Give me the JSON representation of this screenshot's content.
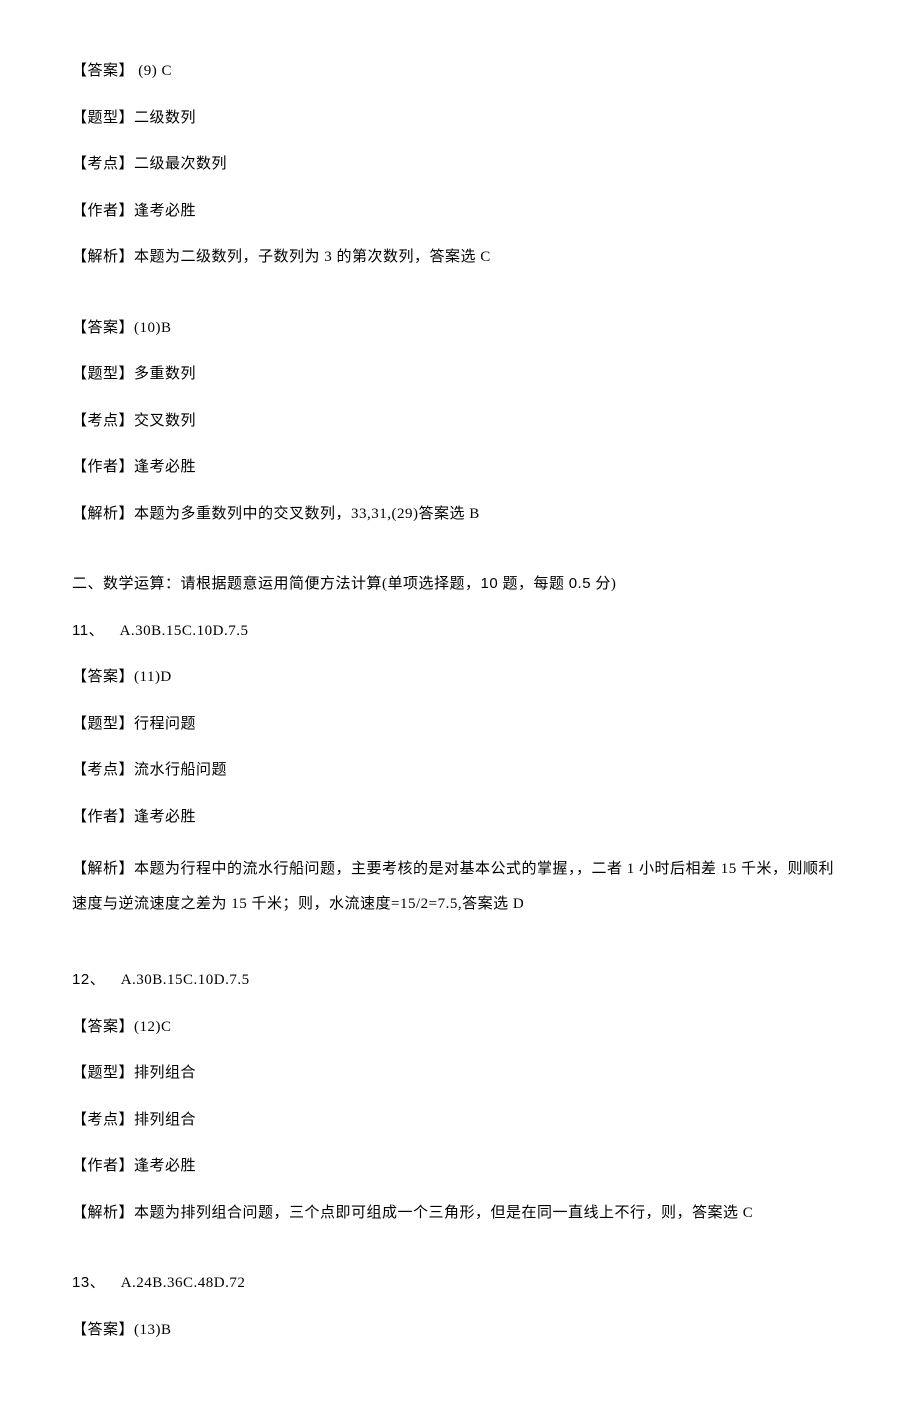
{
  "q9": {
    "answer": "【答案】 (9) C",
    "type": "【题型】二级数列",
    "point": "【考点】二级最次数列",
    "author": "【作者】逢考必胜",
    "analysis": "【解析】本题为二级数列，子数列为 3 的第次数列，答案选 C"
  },
  "q10": {
    "answer": "【答案】(10)B",
    "type": "【题型】多重数列",
    "point": "【考点】交叉数列",
    "author": "【作者】逢考必胜",
    "analysis": "【解析】本题为多重数列中的交叉数列，33,31,(29)答案选 B"
  },
  "section2": {
    "heading_pre": "二、数学运算：请根据题意运用简便方法计算(单项选择题，",
    "heading_mid": "10",
    "heading_post": " 题，每题 ",
    "heading_score": "0.5",
    "heading_end": " 分)"
  },
  "q11": {
    "num": "11",
    "sep": "、 ",
    "options": "A.30B.15C.10D.7.5",
    "answer": "【答案】(11)D",
    "type": "【题型】行程问题",
    "point": "【考点】流水行船问题",
    "author": "【作者】逢考必胜",
    "analysis": "【解析】本题为行程中的流水行船问题，主要考核的是对基本公式的掌握，，二者 1 小时后相差 15 千米，则顺利速度与逆流速度之差为 15 千米；则，水流速度=15/2=7.5,答案选 D"
  },
  "q12": {
    "num": "12",
    "sep": "、 ",
    "options": "A.30B.15C.10D.7.5",
    "answer": "【答案】(12)C",
    "type": "【题型】排列组合",
    "point": "【考点】排列组合",
    "author": "【作者】逢考必胜",
    "analysis": "【解析】本题为排列组合问题，三个点即可组成一个三角形，但是在同一直线上不行，则，答案选 C"
  },
  "q13": {
    "num": "13",
    "sep": "、 ",
    "options": "A.24B.36C.48D.72",
    "answer": "【答案】(13)B"
  }
}
